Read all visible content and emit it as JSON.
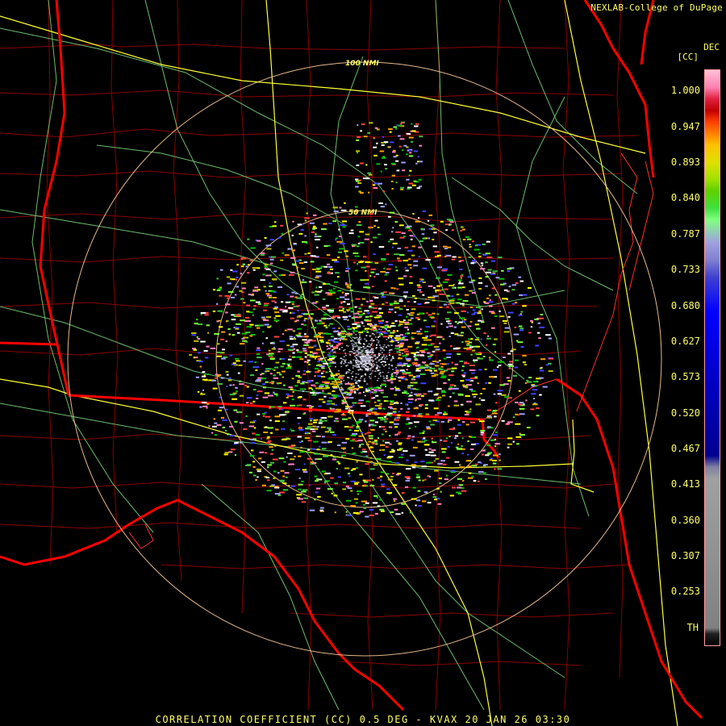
{
  "credit": "NEXLAB-College of DuPage",
  "legend": {
    "title_top": "DEC",
    "title_bottom": "[CC]",
    "labels": [
      "1.000",
      "0.947",
      "0.893",
      "0.840",
      "0.787",
      "0.733",
      "0.680",
      "0.627",
      "0.573",
      "0.520",
      "0.467",
      "0.413",
      "0.360",
      "0.307",
      "0.253",
      "TH"
    ]
  },
  "range_rings": [
    "100 NMI",
    "50 NMI"
  ],
  "caption": "CORRELATION COEFFICIENT (CC) 0.5 DEG - KVAX 20 JAN 26 03:30",
  "colors": {
    "background": "#000000",
    "text": "#ffff66",
    "state_border": "#ff0000",
    "county_border": "#8b0000",
    "highway_major": "#ffff33",
    "highway_minor": "#7fdf7f",
    "range_ring": "#ffcc99"
  }
}
